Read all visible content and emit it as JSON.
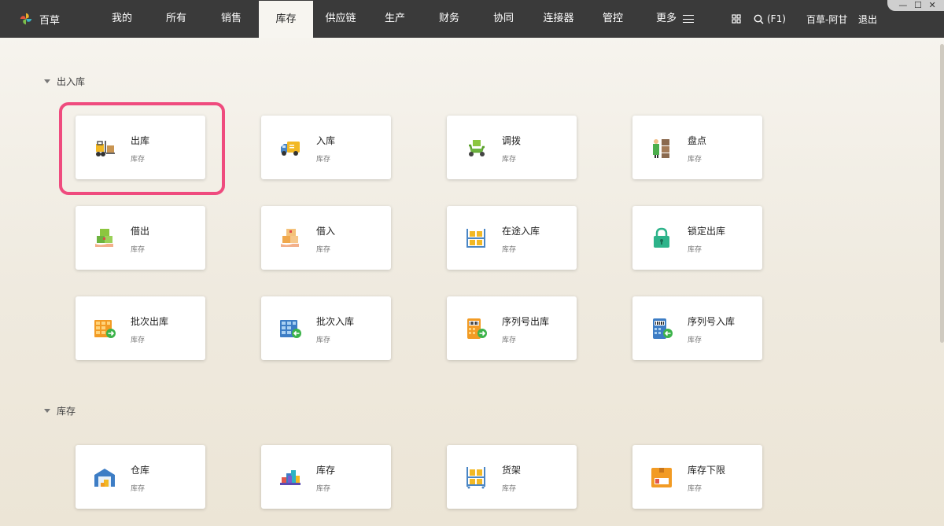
{
  "brand": {
    "name": "百草",
    "icon": "pinwheel-logo-icon"
  },
  "nav": {
    "items": [
      "我的",
      "所有",
      "销售",
      "库存",
      "供应链",
      "生产",
      "财务",
      "协同",
      "连接器",
      "管控",
      "更多"
    ],
    "active": "库存"
  },
  "tools": {
    "grid_icon": "grid-icon",
    "search_shortcut": "(F1)",
    "user": "百草-阿甘",
    "logout": "退出"
  },
  "window_controls": {
    "minimize": "—",
    "maximize": "☐",
    "close": "✕"
  },
  "sections": [
    {
      "title": "出入库",
      "cards": [
        {
          "title": "出库",
          "sub": "库存",
          "icon": "forklift-icon"
        },
        {
          "title": "入库",
          "sub": "库存",
          "icon": "truck-icon"
        },
        {
          "title": "调拨",
          "sub": "库存",
          "icon": "scooter-icon"
        },
        {
          "title": "盘点",
          "sub": "库存",
          "icon": "worker-boxes-icon"
        },
        {
          "title": "借出",
          "sub": "库存",
          "icon": "lend-boxes-icon"
        },
        {
          "title": "借入",
          "sub": "库存",
          "icon": "borrow-boxes-icon"
        },
        {
          "title": "在途入库",
          "sub": "库存",
          "icon": "shelf-icon"
        },
        {
          "title": "锁定出库",
          "sub": "库存",
          "icon": "lock-icon"
        },
        {
          "title": "批次出库",
          "sub": "库存",
          "icon": "batch-out-icon"
        },
        {
          "title": "批次入库",
          "sub": "库存",
          "icon": "batch-in-icon"
        },
        {
          "title": "序列号出库",
          "sub": "库存",
          "icon": "serial-out-icon"
        },
        {
          "title": "序列号入库",
          "sub": "库存",
          "icon": "serial-in-icon"
        }
      ]
    },
    {
      "title": "库存",
      "cards": [
        {
          "title": "仓库",
          "sub": "库存",
          "icon": "warehouse-icon"
        },
        {
          "title": "库存",
          "sub": "库存",
          "icon": "stock-icon"
        },
        {
          "title": "货架",
          "sub": "库存",
          "icon": "rack-icon"
        },
        {
          "title": "库存下限",
          "sub": "库存",
          "icon": "low-stock-icon"
        }
      ]
    }
  ],
  "colors": {
    "highlight": "#ef4b7e",
    "topbar": "#3a3a3a"
  }
}
